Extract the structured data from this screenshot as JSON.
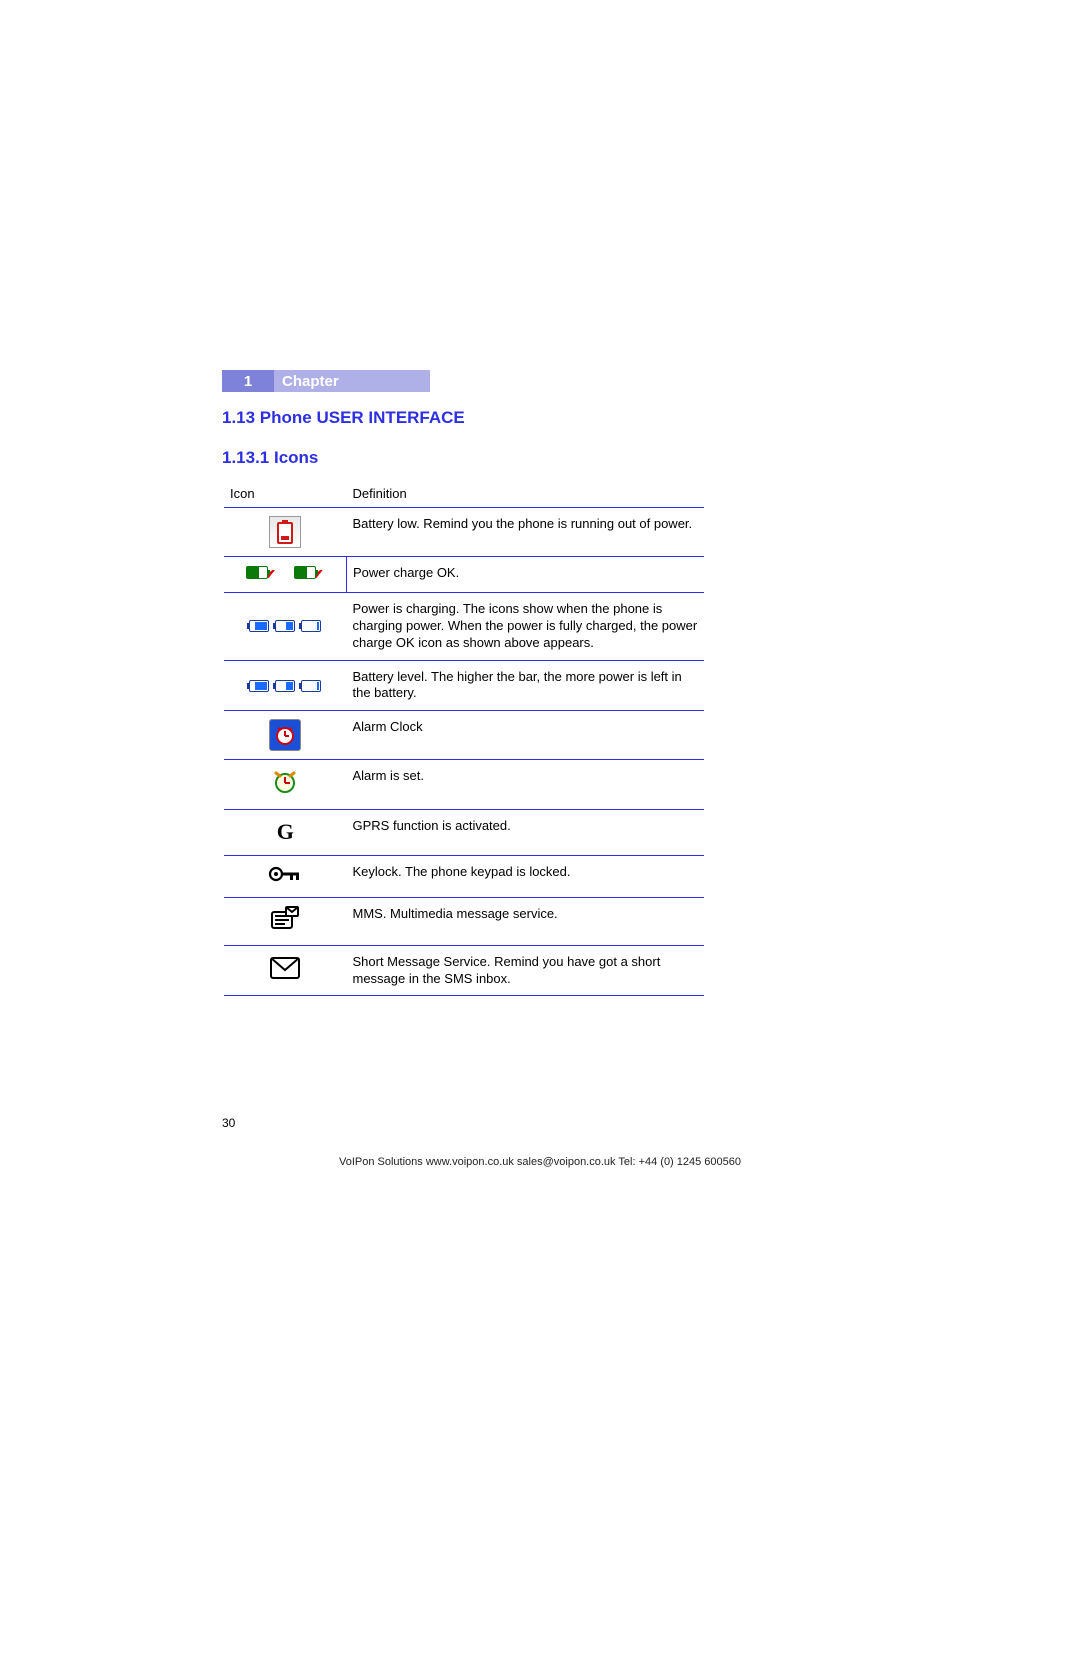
{
  "chapter": {
    "number": "1",
    "label": "Chapter"
  },
  "section": {
    "number_title": "1.13   Phone USER INTERFACE"
  },
  "subsection": {
    "number_title": "1.13.1 Icons"
  },
  "table": {
    "headers": {
      "icon": "Icon",
      "definition": "Definition"
    },
    "rows": [
      {
        "icon_name": "battery-low-icon",
        "definition": "Battery low. Remind you the phone is running out of power."
      },
      {
        "icon_name": "power-charge-ok-icon",
        "definition": "Power charge OK."
      },
      {
        "icon_name": "power-charging-icon",
        "definition": "Power is charging. The icons show when the phone is charging power. When the power is fully charged, the power charge OK icon as shown above appears."
      },
      {
        "icon_name": "battery-level-icon",
        "definition": "Battery level. The higher the bar, the more power is left in the battery."
      },
      {
        "icon_name": "alarm-clock-icon",
        "definition": "Alarm Clock"
      },
      {
        "icon_name": "alarm-set-icon",
        "definition": "Alarm is set."
      },
      {
        "icon_name": "gprs-icon",
        "definition": "GPRS function is activated."
      },
      {
        "icon_name": "keylock-icon",
        "definition": "Keylock. The phone keypad is locked."
      },
      {
        "icon_name": "mms-icon",
        "definition": "MMS. Multimedia message service."
      },
      {
        "icon_name": "sms-icon",
        "definition": "Short Message Service. Remind you have got a short message in the SMS inbox."
      }
    ]
  },
  "page_number": "30",
  "footer": "VoIPon Solutions  www.voipon.co.uk  sales@voipon.co.uk  Tel: +44 (0) 1245 600560"
}
